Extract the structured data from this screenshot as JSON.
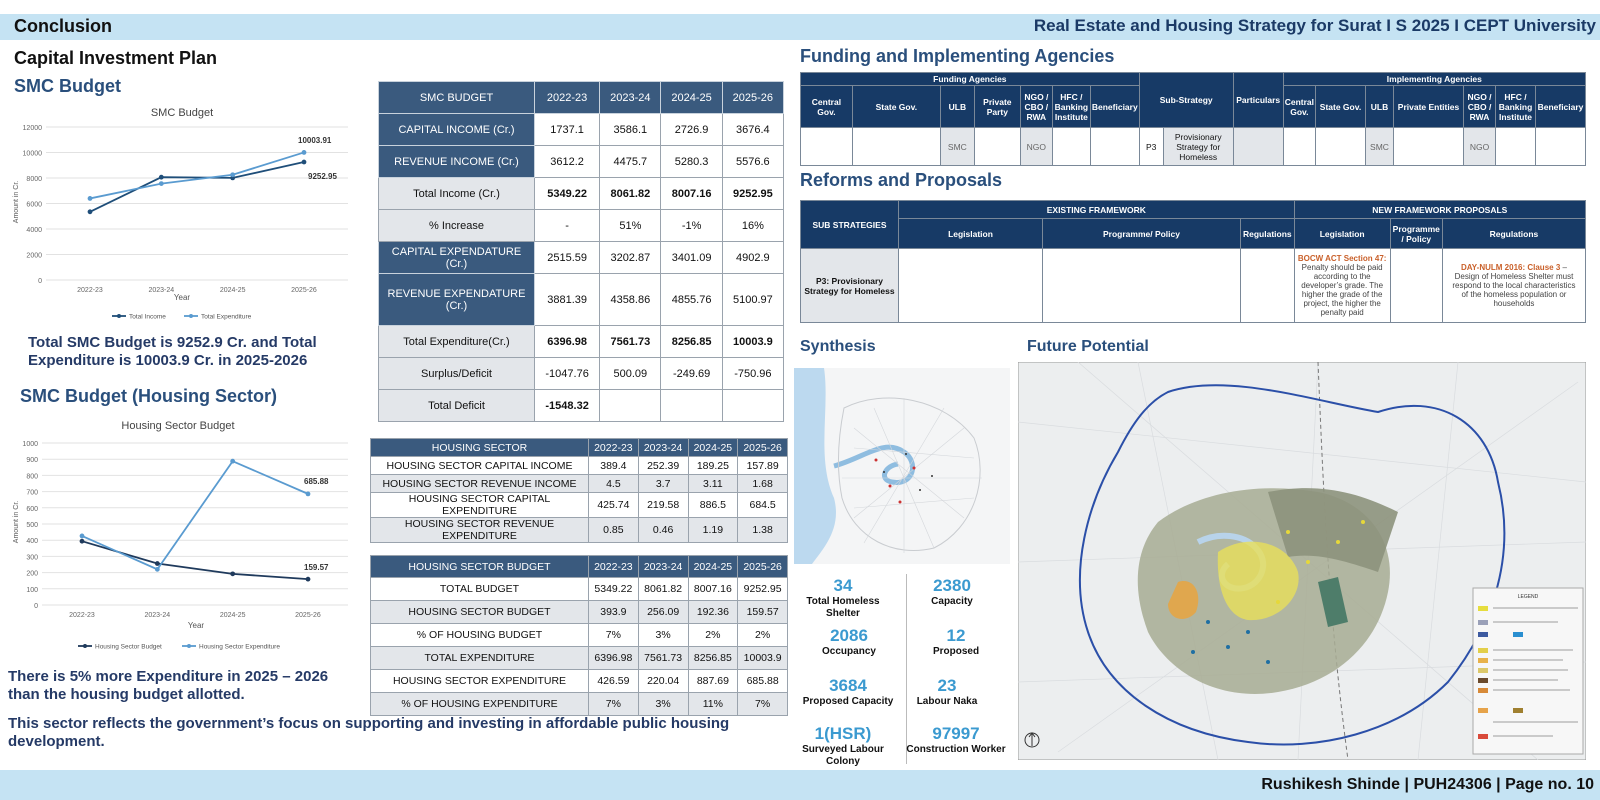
{
  "header": {
    "left": "Conclusion",
    "right": "Real Estate and Housing Strategy for Surat I S 2025 I CEPT University"
  },
  "footer": {
    "text": "Rushikesh Shinde | PUH24306 | Page no. 10"
  },
  "left": {
    "section_title": "Capital Investment Plan",
    "smc_title": "SMC Budget",
    "smc_summary": "Total SMC Budget is 9252.9 Cr. and Total Expenditure is 10003.9 Cr. in 2025-2026",
    "housing_title": "SMC Budget (Housing Sector)",
    "housing_summary1": "There is 5% more Expenditure in 2025 – 2026 than the housing budget allotted.",
    "housing_summary2": "This sector reflects the government’s focus on supporting and investing in affordable public housing development."
  },
  "chart_data": [
    {
      "type": "line",
      "title": "SMC Budget",
      "xlabel": "Year",
      "ylabel": "Amount in Cr.",
      "categories": [
        "2022-23",
        "2023-24",
        "2024-25",
        "2025-26"
      ],
      "ylim": [
        0,
        12000
      ],
      "yticks": [
        "0",
        "2000",
        "4000",
        "6000",
        "8000",
        "10000",
        "12000"
      ],
      "grid": true,
      "legend": "bottom",
      "series": [
        {
          "name": "Total Income",
          "values": [
            5349.22,
            8061.82,
            8007.16,
            9252.95
          ],
          "color": "#1f4e79"
        },
        {
          "name": "Total Expenditure",
          "values": [
            6396.98,
            7561.73,
            8256.85,
            10003.9
          ],
          "color": "#5a9bd0"
        }
      ],
      "annotations": [
        "10003.91",
        "9252.95"
      ]
    },
    {
      "type": "line",
      "title": "Housing Sector Budget",
      "xlabel": "Year",
      "ylabel": "Amount in Cr.",
      "categories": [
        "2022-23",
        "2023-24",
        "2024-25",
        "2025-26"
      ],
      "ylim": [
        0,
        1000
      ],
      "yticks": [
        "0",
        "100",
        "200",
        "300",
        "400",
        "500",
        "600",
        "700",
        "800",
        "900",
        "1000"
      ],
      "grid": true,
      "legend": "bottom",
      "series": [
        {
          "name": "Housing Sector Budget",
          "values": [
            393.9,
            256.09,
            192.36,
            159.57
          ],
          "color": "#1f3a5c"
        },
        {
          "name": "Housing Sector Expenditure",
          "values": [
            426.59,
            220.04,
            887.69,
            685.88
          ],
          "color": "#5a9bd0"
        }
      ],
      "annotations": [
        "685.88",
        "159.57"
      ]
    }
  ],
  "smc_table": {
    "headers": [
      "SMC BUDGET",
      "2022-23",
      "2023-24",
      "2024-25",
      "2025-26"
    ],
    "rows": [
      {
        "label": "CAPITAL INCOME (Cr.)",
        "values": [
          "1737.1",
          "3586.1",
          "2726.9",
          "3676.4"
        ],
        "style": "dark"
      },
      {
        "label": "REVENUE INCOME (Cr.)",
        "values": [
          "3612.2",
          "4475.7",
          "5280.3",
          "5576.6"
        ],
        "style": "dark"
      },
      {
        "label": "Total Income (Cr.)",
        "values": [
          "5349.22",
          "8061.82",
          "8007.16",
          "9252.95"
        ],
        "style": "light",
        "bold": true
      },
      {
        "label": "% Increase",
        "values": [
          "-",
          "51%",
          "-1%",
          "16%"
        ],
        "style": "light"
      },
      {
        "label": "CAPITAL EXPENDATURE (Cr.)",
        "values": [
          "2515.59",
          "3202.87",
          "3401.09",
          "4902.9"
        ],
        "style": "dark"
      },
      {
        "label": "REVENUE EXPENDATURE (Cr.)",
        "values": [
          "3881.39",
          "4358.86",
          "4855.76",
          "5100.97"
        ],
        "style": "dark",
        "tall": true
      },
      {
        "label": "Total Expenditure(Cr.)",
        "values": [
          "6396.98",
          "7561.73",
          "8256.85",
          "10003.9"
        ],
        "style": "light",
        "bold": true
      },
      {
        "label": "Surplus/Deficit",
        "values": [
          "-1047.76",
          "500.09",
          "-249.69",
          "-750.96"
        ],
        "style": "light"
      },
      {
        "label": "Total Deficit",
        "values": [
          "-1548.32",
          "",
          "",
          ""
        ],
        "style": "light",
        "bold": true
      }
    ]
  },
  "housing_table": {
    "headers": [
      "HOUSING SECTOR",
      "2022-23",
      "2023-24",
      "2024-25",
      "2025-26"
    ],
    "rows": [
      {
        "label": "HOUSING SECTOR CAPITAL INCOME",
        "values": [
          "389.4",
          "252.39",
          "189.25",
          "157.89"
        ]
      },
      {
        "label": "HOUSING SECTOR REVENUE INCOME",
        "values": [
          "4.5",
          "3.7",
          "3.11",
          "1.68"
        ]
      },
      {
        "label": "HOUSING SECTOR CAPITAL EXPENDITURE",
        "values": [
          "425.74",
          "219.58",
          "886.5",
          "684.5"
        ]
      },
      {
        "label": "HOUSING SECTOR REVENUE EXPENDITURE",
        "values": [
          "0.85",
          "0.46",
          "1.19",
          "1.38"
        ]
      }
    ]
  },
  "housing_budget_table": {
    "headers": [
      "HOUSING SECTOR BUDGET",
      "2022-23",
      "2023-24",
      "2024-25",
      "2025-26"
    ],
    "rows": [
      {
        "label": "TOTAL BUDGET",
        "values": [
          "5349.22",
          "8061.82",
          "8007.16",
          "9252.95"
        ]
      },
      {
        "label": "HOUSING SECTOR BUDGET",
        "values": [
          "393.9",
          "256.09",
          "192.36",
          "159.57"
        ]
      },
      {
        "label": "% OF HOUSING BUDGET",
        "values": [
          "7%",
          "3%",
          "2%",
          "2%"
        ]
      },
      {
        "label": "TOTAL EXPENDITURE",
        "values": [
          "6396.98",
          "7561.73",
          "8256.85",
          "10003.9"
        ]
      },
      {
        "label": "HOUSING SECTOR EXPENDITURE",
        "values": [
          "426.59",
          "220.04",
          "887.69",
          "685.88"
        ]
      },
      {
        "label": "% OF HOUSING EXPENDITURE",
        "values": [
          "7%",
          "3%",
          "11%",
          "7%"
        ]
      }
    ]
  },
  "agencies": {
    "title": "Funding and Implementing Agencies",
    "funding_label": "Funding Agencies",
    "implementing_label": "Implementing Agencies",
    "funding_cols": [
      "Central Gov.",
      "State Gov.",
      "ULB",
      "Private Party",
      "NGO / CBO / RWA",
      "HFC / Banking Institute",
      "Beneficiary"
    ],
    "sub_strategy": "Sub-Strategy",
    "particulars": "Particulars",
    "impl_cols": [
      "Central Gov.",
      "State Gov.",
      "ULB",
      "Private Entities",
      "NGO / CBO / RWA",
      "HFC / Banking Institute",
      "Beneficiary"
    ],
    "row": {
      "ulb": "SMC",
      "ngo": "NGO",
      "code": "P3",
      "strategy": "Provisionary Strategy for Homeless",
      "impl_ulb": "SMC",
      "impl_ngo": "NGO"
    }
  },
  "reforms": {
    "title": "Reforms and Proposals",
    "sub_strategies": "SUB STRATEGIES",
    "existing": "EXISTING FRAMEWORK",
    "new": "NEW FRAMEWORK PROPOSALS",
    "cols_existing": [
      "Legislation",
      "Programme/ Policy",
      "Regulations"
    ],
    "cols_new": [
      "Legislation",
      "Programme / Policy",
      "Regulations"
    ],
    "row_label": "P3: Provisionary Strategy for Homeless",
    "bocw_head": "BOCW ACT Section 47:",
    "bocw_body": "Penalty should be paid according to the developer’s grade. The higher the grade of the project, the higher the penalty paid",
    "nulm_head": "DAY-NULM 2016: Clause 3",
    "nulm_body": " – Design of Homeless Shelter must respond to the local characteristics of the homeless population or households"
  },
  "synthesis": {
    "title": "Synthesis",
    "stats": [
      {
        "value": "34",
        "label": "Total Homeless Shelter"
      },
      {
        "value": "2380",
        "label": "Capacity"
      },
      {
        "value": "2086",
        "label": "Occupancy"
      },
      {
        "value": "12",
        "label": "Proposed"
      },
      {
        "value": "3684",
        "label": "Proposed Capacity"
      },
      {
        "value": "23",
        "label": "Labour Naka"
      },
      {
        "value": "1(HSR)",
        "label": "Surveyed Labour Colony"
      },
      {
        "value": "97997",
        "label": "Construction Worker"
      }
    ]
  },
  "future": {
    "title": "Future Potential",
    "legend_title": "LEGEND"
  },
  "colors": {
    "header_band": "#c5e3f3",
    "title_blue": "#1b3a66",
    "table_dark": "#3a5a7e",
    "agency_dark": "#173a66",
    "stat_blue": "#3b9ad0"
  }
}
